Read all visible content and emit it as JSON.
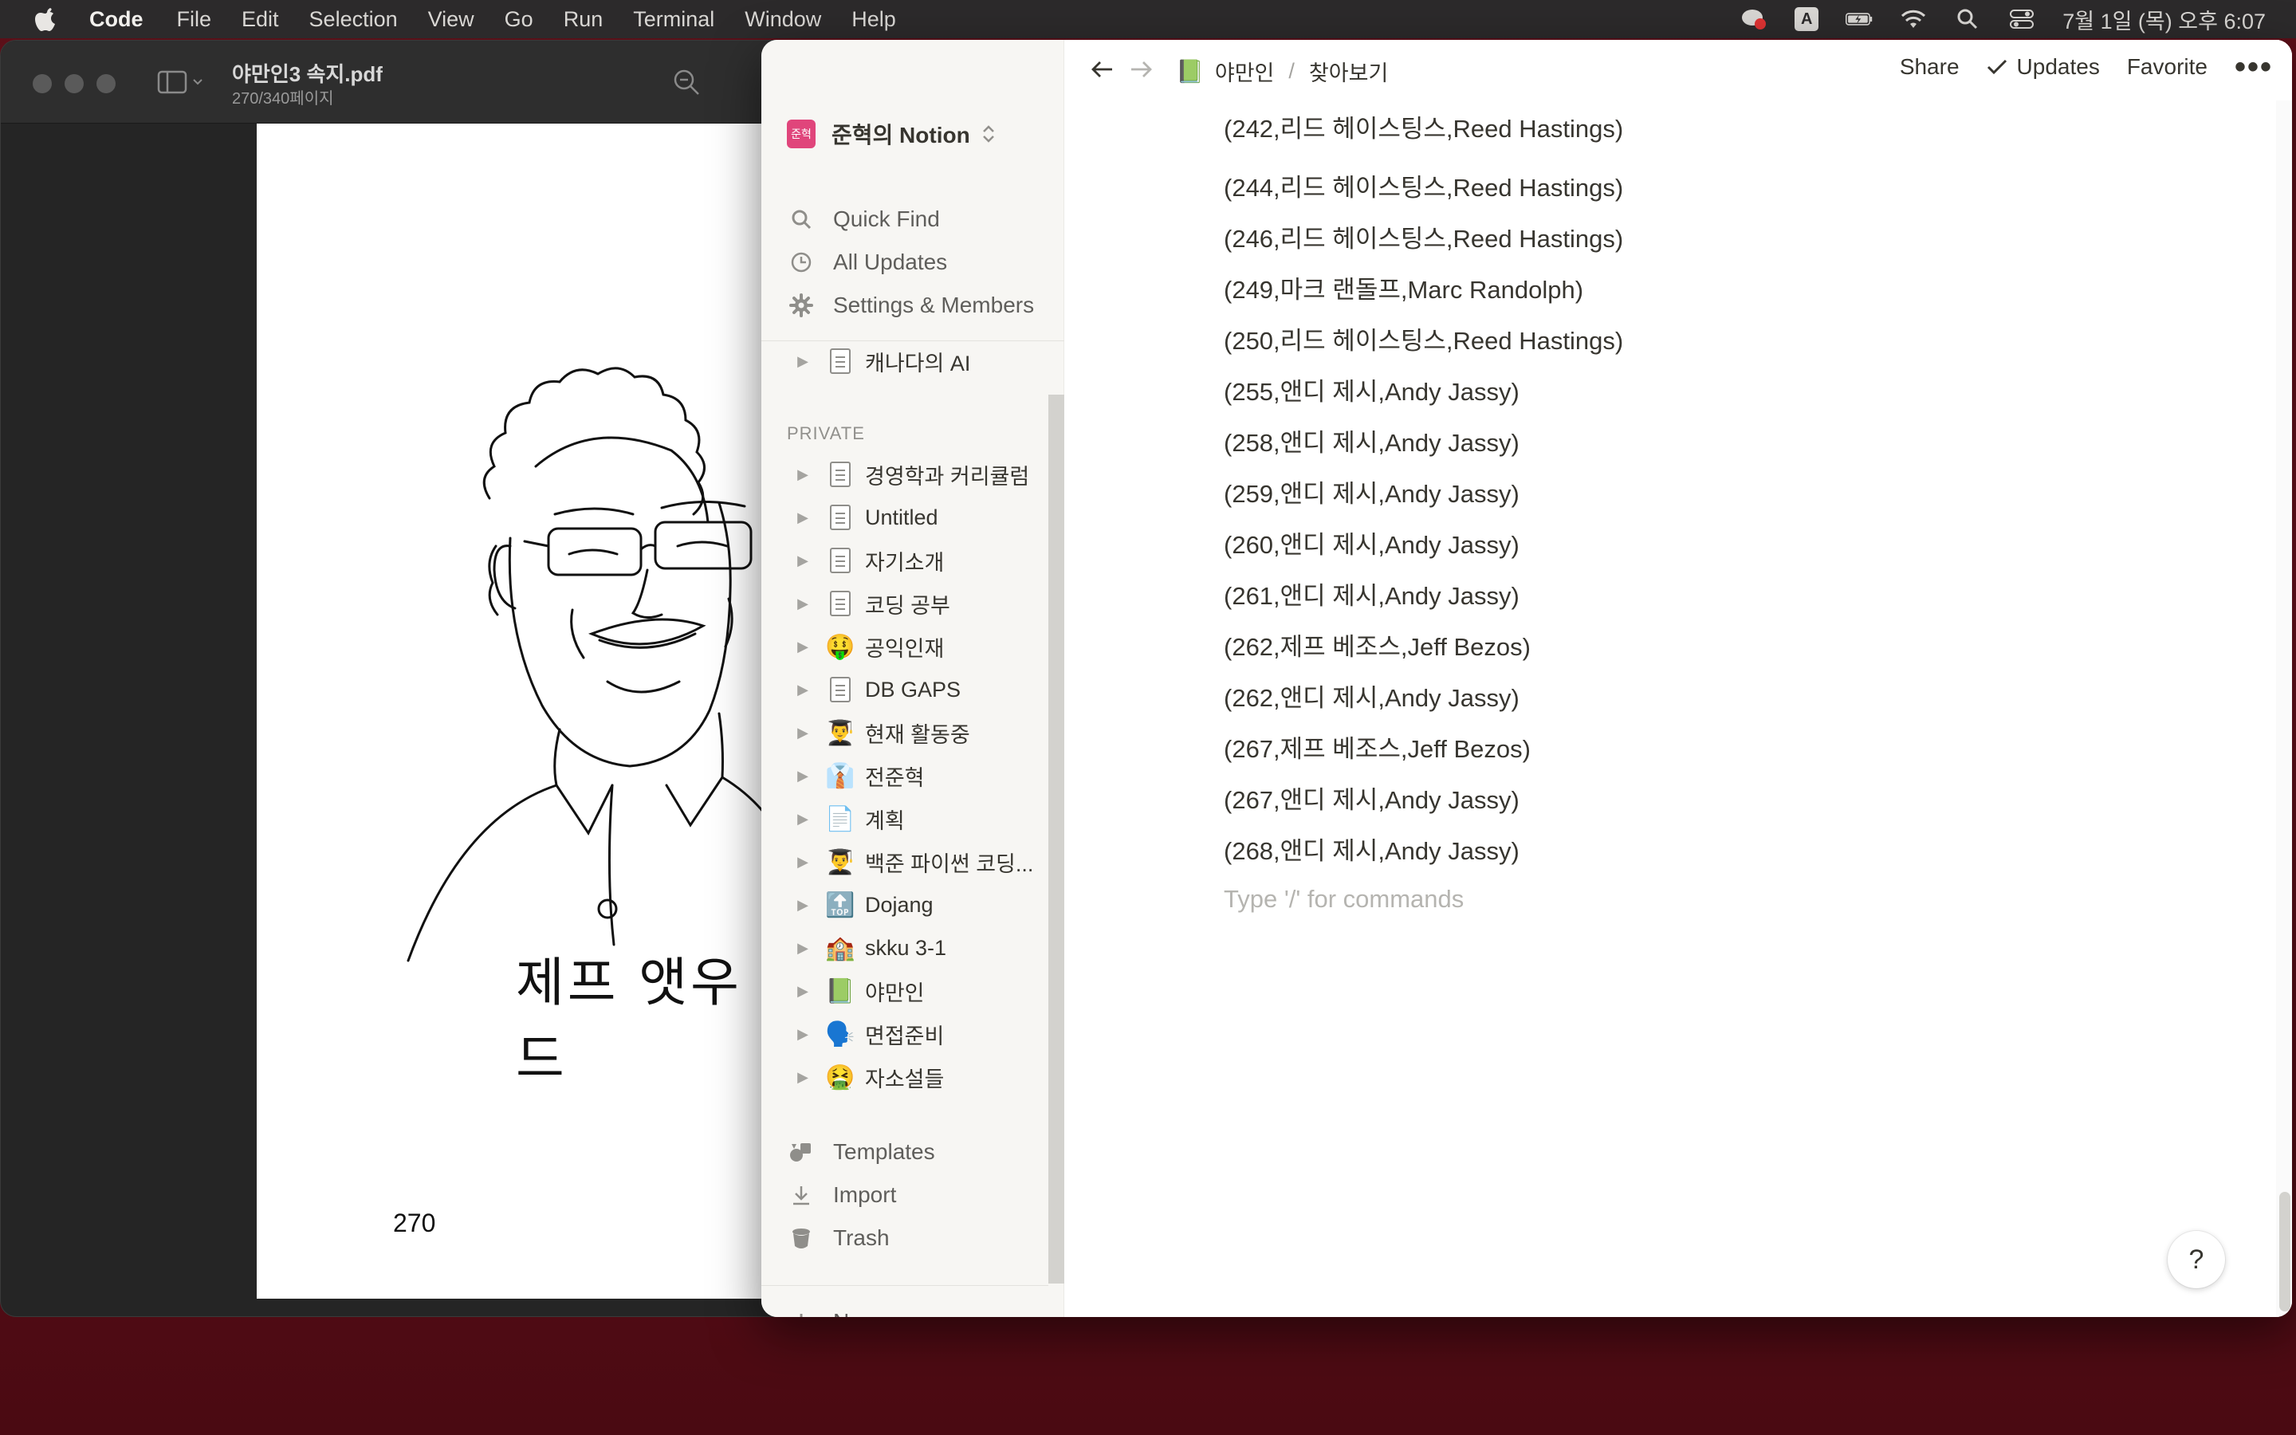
{
  "menubar": {
    "app_name": "Code",
    "items": [
      "File",
      "Edit",
      "Selection",
      "View",
      "Go",
      "Run",
      "Terminal",
      "Window",
      "Help"
    ],
    "ime_label": "A",
    "clock": "7월 1일 (목) 오후 6:07"
  },
  "pdf": {
    "title": "야만인3 속지.pdf",
    "subtitle": "270/340페이지",
    "caption": "제프 앳우드",
    "page_number": "270"
  },
  "notion": {
    "workspace": {
      "avatar": "준혁",
      "name": "준혁의 Notion"
    },
    "actions": {
      "quick_find": "Quick Find",
      "all_updates": "All Updates",
      "settings": "Settings & Members"
    },
    "shared_pages": [
      {
        "label": "캐나다의 AI",
        "icon": "doc"
      }
    ],
    "private_label": "PRIVATE",
    "private_pages": [
      {
        "label": "경영학과 커리큘럼",
        "icon": "doc"
      },
      {
        "label": "Untitled",
        "icon": "doc"
      },
      {
        "label": "자기소개",
        "icon": "doc"
      },
      {
        "label": "코딩 공부",
        "icon": "doc"
      },
      {
        "label": "공익인재",
        "icon": "🤑"
      },
      {
        "label": "DB GAPS",
        "icon": "doc"
      },
      {
        "label": "현재 활동중",
        "icon": "👨‍🎓"
      },
      {
        "label": "전준혁",
        "icon": "👔"
      },
      {
        "label": "계획",
        "icon": "📄"
      },
      {
        "label": "백준 파이썬 코딩...",
        "icon": "👨‍🎓"
      },
      {
        "label": "Dojang",
        "icon": "🔝"
      },
      {
        "label": "skku 3-1",
        "icon": "🏫"
      },
      {
        "label": "야만인",
        "icon": "📗"
      },
      {
        "label": "면접준비",
        "icon": "🗣️"
      },
      {
        "label": "자소설들",
        "icon": "🤮"
      }
    ],
    "footer": {
      "templates": "Templates",
      "import": "Import",
      "trash": "Trash",
      "new_page": "New page"
    },
    "topbar": {
      "breadcrumb_icon": "📗",
      "breadcrumb_parent": "야만인",
      "breadcrumb_sep": "/",
      "breadcrumb_current": "찾아보기",
      "share": "Share",
      "updates": "Updates",
      "favorite": "Favorite",
      "more": "•••"
    },
    "cut_entry": "(242,리드 헤이스팅스,Reed Hastings)",
    "entries": [
      "(244,리드 헤이스팅스,Reed Hastings)",
      "(246,리드 헤이스팅스,Reed Hastings)",
      "(249,마크 랜돌프,Marc Randolph)",
      "(250,리드 헤이스팅스,Reed Hastings)",
      "(255,앤디 제시,Andy Jassy)",
      "(258,앤디 제시,Andy Jassy)",
      "(259,앤디 제시,Andy Jassy)",
      "(260,앤디 제시,Andy Jassy)",
      "(261,앤디 제시,Andy Jassy)",
      "(262,제프 베조스,Jeff Bezos)",
      "(262,앤디 제시,Andy Jassy)",
      "(267,제프 베조스,Jeff Bezos)",
      "(267,앤디 제시,Andy Jassy)",
      "(268,앤디 제시,Andy Jassy)"
    ],
    "placeholder": "Type '/' for commands",
    "help": "?"
  }
}
